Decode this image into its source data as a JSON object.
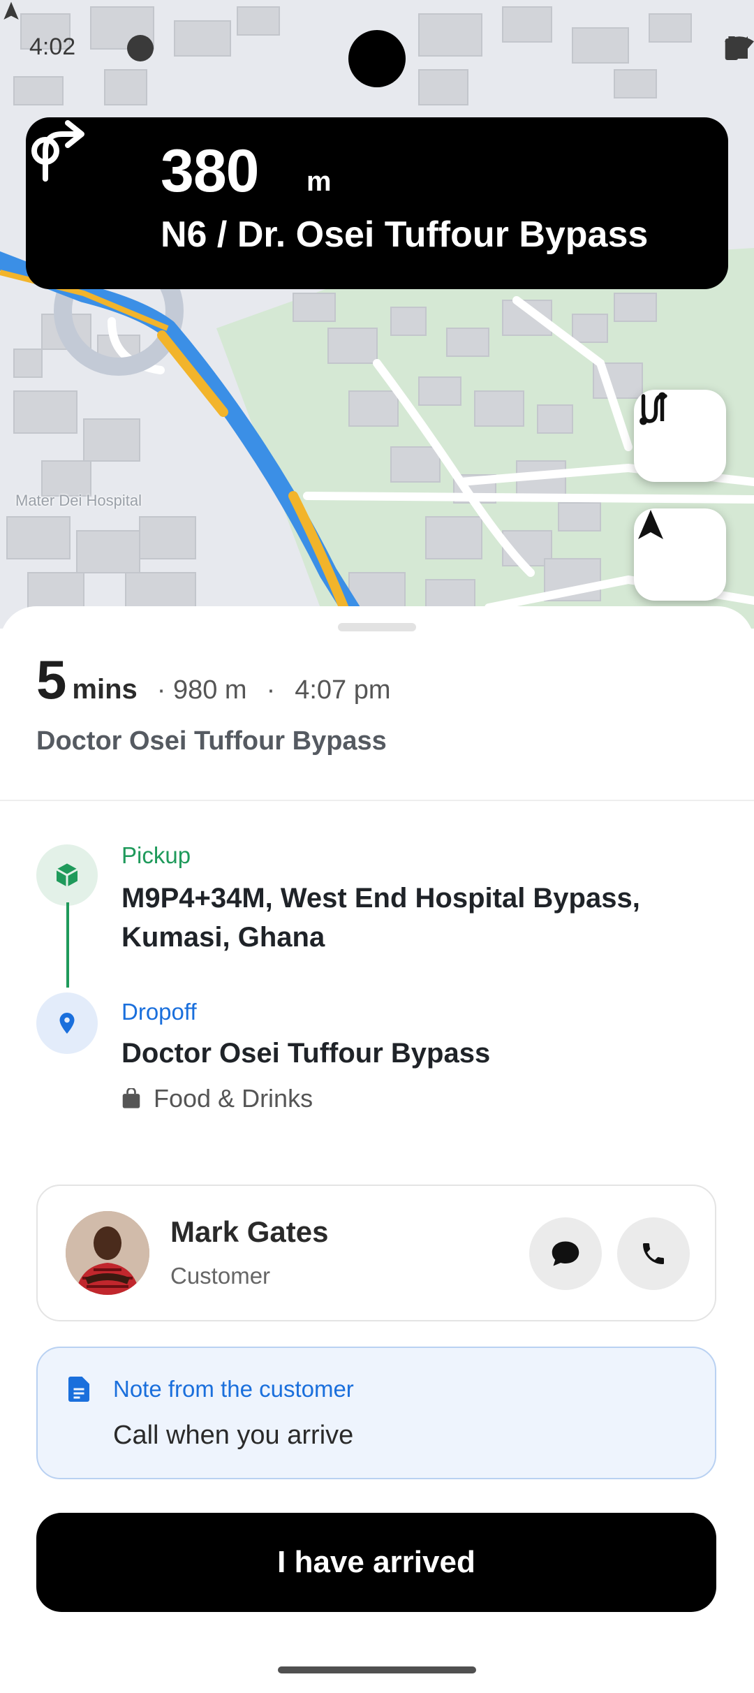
{
  "status_bar": {
    "time": "4:02"
  },
  "navigation": {
    "distance_value": "380",
    "distance_unit": "m",
    "street": "N6 / Dr. Osei Tuffour Bypass",
    "turn_icon": "turn-right-arrow"
  },
  "map": {
    "poi_label": "Mater Dei Hospital",
    "route_color": "#3b8fe6",
    "traffic_color": "#f2b42b",
    "green_area_color": "#d5e8d4"
  },
  "trip_summary": {
    "eta_value": "5",
    "eta_unit": "mins",
    "distance": "· 980 m",
    "separator": "·",
    "arrival_time": "4:07 pm",
    "destination_title": "Doctor Osei Tuffour Bypass"
  },
  "pickup": {
    "label": "Pickup",
    "address": "M9P4+34M, West End Hospital Bypass, Kumasi, Ghana",
    "icon": "package-icon",
    "color": "#1f9a5b"
  },
  "dropoff": {
    "label": "Dropoff",
    "address": "Doctor Osei Tuffour Bypass",
    "category": "Food & Drinks",
    "icon": "location-pin-icon",
    "color": "#1a6fdc"
  },
  "customer": {
    "name": "Mark Gates",
    "role": "Customer"
  },
  "note": {
    "title": "Note from the customer",
    "text": "Call when you arrive"
  },
  "actions": {
    "arrived_label": "I have arrived"
  }
}
